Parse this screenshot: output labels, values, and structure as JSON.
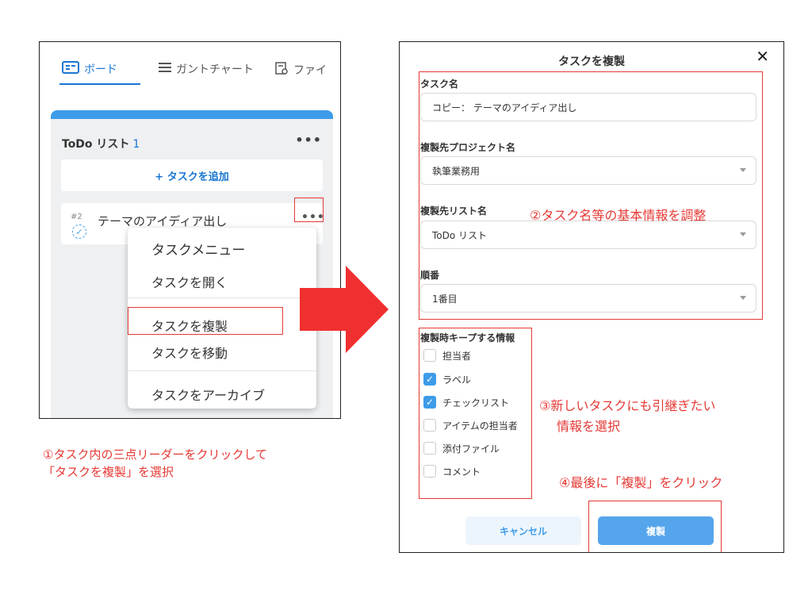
{
  "left_panel": {
    "tabs": [
      {
        "label": "ボード",
        "icon": "board-icon"
      },
      {
        "label": "ガントチャート",
        "icon": "gantt-icon"
      },
      {
        "label": "ファイ",
        "icon": "file-icon"
      }
    ],
    "list": {
      "title": "ToDo リスト",
      "count": "1",
      "more": "•••",
      "add_task_label": "+ タスクを追加"
    },
    "task": {
      "number": "#2",
      "title": "テーマのアイディア出し",
      "more": "•••"
    },
    "menu": {
      "header": "タスクメニュー",
      "items": [
        "タスクを開く",
        "タスクを複製",
        "タスクを移動",
        "タスクをアーカイブ"
      ]
    }
  },
  "captions": {
    "step1_line1": "①タスク内の三点リーダーをクリックして",
    "step1_line2": "「タスクを複製」を選択",
    "step2": "②タスク名等の基本情報を調整",
    "step3_line1": "③新しいタスクにも引継ぎたい",
    "step3_line2": "情報を選択",
    "step4": "④最後に「複製」をクリック"
  },
  "dialog": {
    "title": "タスクを複製",
    "close": "✕",
    "task_name_label": "タスク名",
    "task_name_value": "コピー：  テーマのアイディア出し",
    "project_label": "複製先プロジェクト名",
    "project_value": "執筆業務用",
    "list_label": "複製先リスト名",
    "list_value": "ToDo リスト",
    "order_label": "順番",
    "order_value": "1番目",
    "keep_title": "複製時キープする情報",
    "keep_items": [
      {
        "label": "担当者",
        "checked": false
      },
      {
        "label": "ラベル",
        "checked": true
      },
      {
        "label": "チェックリスト",
        "checked": true
      },
      {
        "label": "アイテムの担当者",
        "checked": false
      },
      {
        "label": "添付ファイル",
        "checked": false
      },
      {
        "label": "コメント",
        "checked": false
      }
    ],
    "cancel_label": "キャンセル",
    "duplicate_label": "複製"
  },
  "colors": {
    "accent": "#3d9be9",
    "highlight": "#e53935",
    "arrow": "#f03030"
  }
}
